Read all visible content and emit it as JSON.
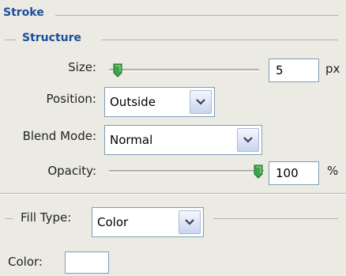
{
  "sections": {
    "stroke_title": "Stroke",
    "structure_title": "Structure"
  },
  "size": {
    "label": "Size:",
    "value": "5",
    "unit": "px",
    "slider_fraction": 0.02
  },
  "position": {
    "label": "Position:",
    "selected": "Outside"
  },
  "blend_mode": {
    "label": "Blend Mode:",
    "selected": "Normal"
  },
  "opacity": {
    "label": "Opacity:",
    "value": "100",
    "unit": "%",
    "slider_fraction": 1.0
  },
  "fill_type": {
    "label": "Fill Type:",
    "selected": "Color"
  },
  "color": {
    "label": "Color:",
    "swatch": "#ffffff"
  },
  "colors": {
    "section_title": "#1d4e9a",
    "panel_bg": "#ecebe3",
    "field_border": "#7f9db9",
    "thumb": "#3fa34a"
  },
  "icons": {
    "dropdown_arrow": "chevron-down-icon",
    "slider_thumb": "slider-thumb-icon"
  }
}
